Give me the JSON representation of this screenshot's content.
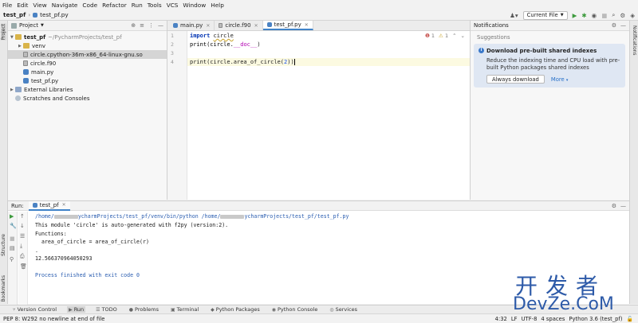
{
  "menu": [
    "File",
    "Edit",
    "View",
    "Navigate",
    "Code",
    "Refactor",
    "Run",
    "Tools",
    "VCS",
    "Window",
    "Help"
  ],
  "nav": {
    "project": "test_pf",
    "file": "test_pf.py",
    "run_config": "Current File"
  },
  "left_strip": {
    "project": "Project",
    "structure": "Structure",
    "bookmarks": "Bookmarks"
  },
  "right_strip": {
    "notifications": "Notifications"
  },
  "project_panel": {
    "title": "Project",
    "root_name": "test_pf",
    "root_path": "~/PycharmProjects/test_pf",
    "items": [
      {
        "label": "venv",
        "kind": "folder"
      },
      {
        "label": "circle.cpython-36m-x86_64-linux-gnu.so",
        "kind": "file"
      },
      {
        "label": "circle.f90",
        "kind": "file"
      },
      {
        "label": "main.py",
        "kind": "py"
      },
      {
        "label": "test_pf.py",
        "kind": "py"
      }
    ],
    "external": "External Libraries",
    "scratches": "Scratches and Consoles"
  },
  "editor": {
    "tabs": [
      "main.py",
      "circle.f90",
      "test_pf.py"
    ],
    "active_tab": "test_pf.py",
    "line_numbers": [
      "1",
      "2",
      "3",
      "4"
    ],
    "inspections": {
      "errors": "1",
      "warnings": "1"
    },
    "code": {
      "l1_kw": "import",
      "l1_mod": "circle",
      "l2_a": "print(circle.",
      "l2_b": "__doc__",
      "l2_c": ")",
      "l4_a": "print(circle.area_of_circle(",
      "l4_num": "2",
      "l4_c": "))"
    }
  },
  "notifications": {
    "title": "Notifications",
    "section": "Suggestions",
    "card_title": "Download pre-built shared indexes",
    "card_body": "Reduce the indexing time and CPU load with pre-built Python packages shared indexes",
    "btn_download": "Always download",
    "btn_more": "More"
  },
  "run": {
    "label": "Run:",
    "tab": "test_pf",
    "output": {
      "cmd_a": "/home/",
      "cmd_b": "ycharmProjects/test_pf/venv/bin/python /home/",
      "cmd_c": "ycharmProjects/test_pf/test_pf.py",
      "o2": "This module 'circle' is auto-generated with f2py (version:2).",
      "o3": "Functions:",
      "o4": "  area_of_circle = area_of_circle(r)",
      "o5": ".",
      "o6": "12.566370964050293",
      "o7": "Process finished with exit code 0"
    }
  },
  "tool_tabs": [
    "Version Control",
    "Run",
    "TODO",
    "Problems",
    "Terminal",
    "Python Packages",
    "Python Console",
    "Services"
  ],
  "status": {
    "message": "PEP 8: W292 no newline at end of file",
    "position": "4:32",
    "line_sep": "LF",
    "encoding": "UTF-8",
    "indent": "4 spaces",
    "interpreter": "Python 3.6 (test_pf)"
  },
  "watermark": {
    "cn": "开发者",
    "en": "DevZe.CoM"
  }
}
